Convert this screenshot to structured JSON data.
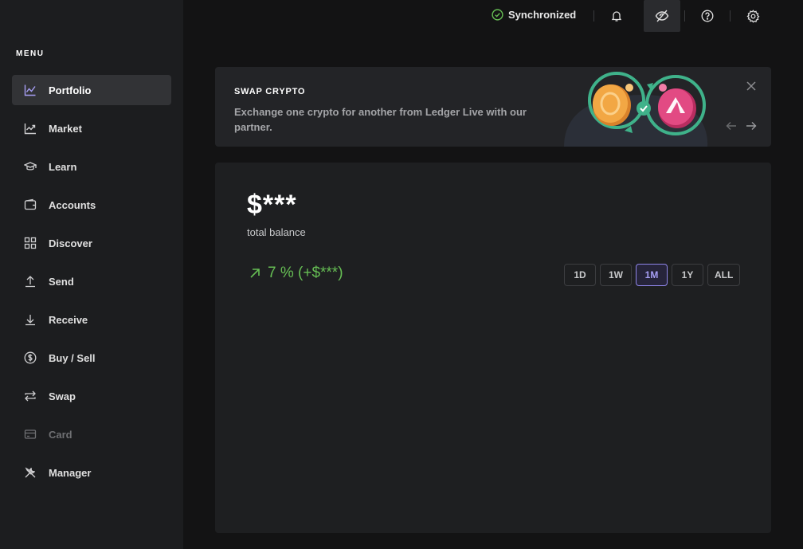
{
  "sidebar": {
    "menu_label": "MENU",
    "items": [
      {
        "label": "Portfolio",
        "icon": "chart-line-icon"
      },
      {
        "label": "Market",
        "icon": "trend-icon"
      },
      {
        "label": "Learn",
        "icon": "graduation-cap-icon"
      },
      {
        "label": "Accounts",
        "icon": "wallet-icon"
      },
      {
        "label": "Discover",
        "icon": "grid-icon"
      },
      {
        "label": "Send",
        "icon": "arrow-up-icon"
      },
      {
        "label": "Receive",
        "icon": "arrow-down-icon"
      },
      {
        "label": "Buy / Sell",
        "icon": "dollar-circle-icon"
      },
      {
        "label": "Swap",
        "icon": "swap-arrows-icon"
      },
      {
        "label": "Card",
        "icon": "card-icon"
      },
      {
        "label": "Manager",
        "icon": "tools-icon"
      }
    ],
    "active_item": "Portfolio",
    "disabled_item": "Card"
  },
  "topbar": {
    "sync_status": "Synchronized",
    "icons": [
      "bell-icon",
      "eye-off-icon",
      "help-icon",
      "settings-icon"
    ]
  },
  "banner": {
    "title": "SWAP CRYPTO",
    "description": "Exchange one crypto for another from Ledger Live with our partner."
  },
  "portfolio": {
    "balance": "$***",
    "balance_label": "total balance",
    "change": "7 % (+$***)",
    "ranges": [
      "1D",
      "1W",
      "1M",
      "1Y",
      "ALL"
    ],
    "selected_range": "1M"
  },
  "colors": {
    "accent": "#a79ff5",
    "positive": "#66be54",
    "background": "#131314",
    "sidebar": "#1c1d1f"
  }
}
